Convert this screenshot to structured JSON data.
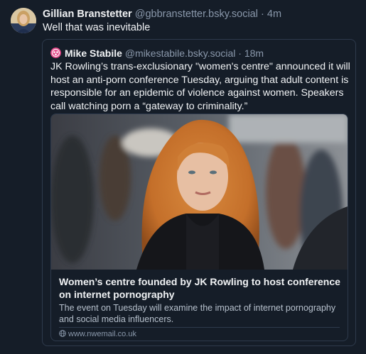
{
  "post": {
    "author_name": "Gillian Branstetter",
    "author_handle": "@gbbranstetter.bsky.social",
    "separator": "·",
    "time": "4m",
    "text": "Well that was inevitable"
  },
  "quote": {
    "author_name": "Mike Stabile",
    "author_handle": "@mikestabile.bsky.social",
    "separator": "·",
    "time": "18m",
    "text": "JK Rowling’s trans-exclusionary \"women's centre\" announced it will host an anti-porn conference Tuesday, arguing that adult content is responsible for an epidemic of violence against women. Speakers call watching porn a “gateway to criminality.”"
  },
  "link_card": {
    "title": "Women’s centre founded by JK Rowling to host conference on internet pornography",
    "description": "The event on Tuesday will examine the impact of internet pornography and social media influencers.",
    "domain": "www.nwemail.co.uk",
    "icon": "globe-icon"
  },
  "colors": {
    "background": "#151d28",
    "border": "#2e3a4c",
    "text_primary": "#f1f3f5",
    "text_secondary": "#8a98ab"
  }
}
